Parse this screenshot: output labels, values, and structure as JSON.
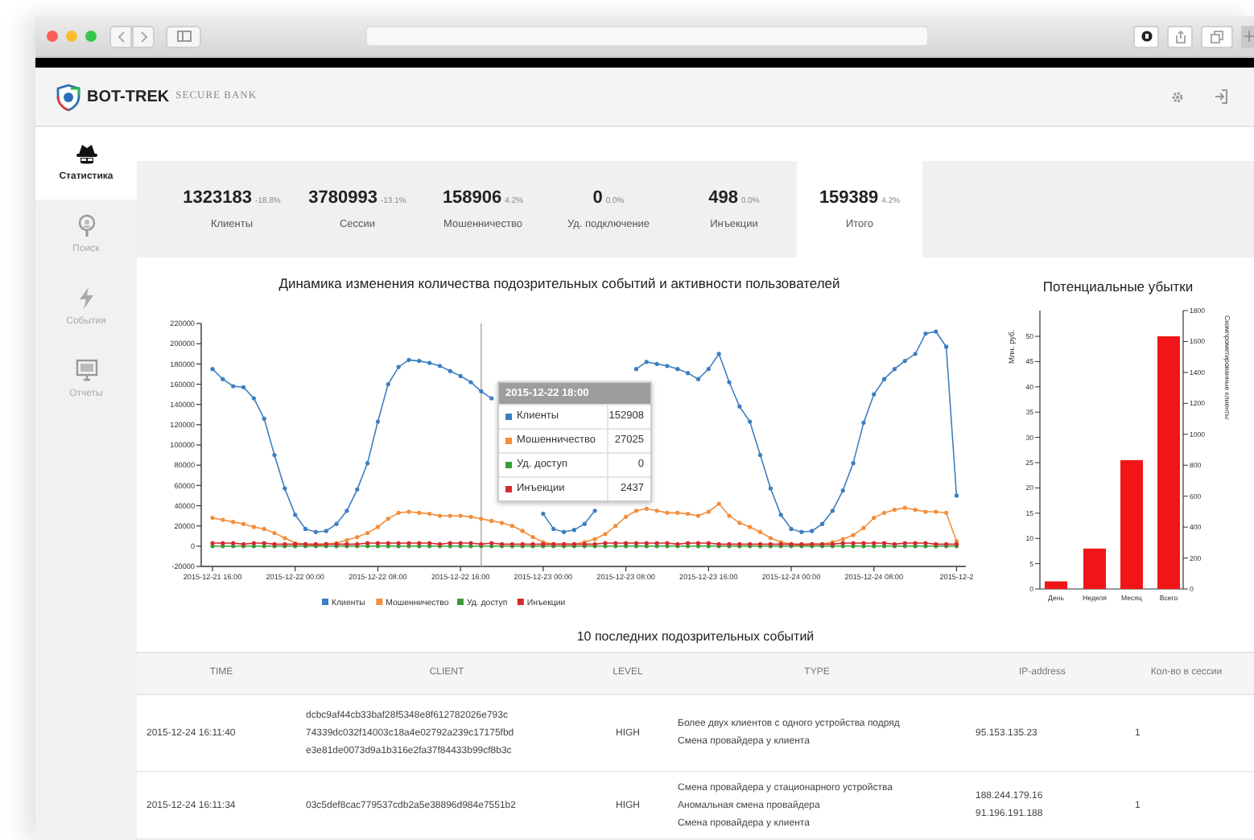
{
  "header": {
    "brand": "BOT-TREK",
    "subtitle": "SECURE BANK"
  },
  "sidebar": {
    "items": [
      {
        "label": "Статистика",
        "kind": "agent",
        "selected": true
      },
      {
        "label": "Поиск",
        "kind": "search",
        "selected": false
      },
      {
        "label": "События",
        "kind": "lightning",
        "selected": false
      },
      {
        "label": "Отчеты",
        "kind": "monitor",
        "selected": false
      }
    ]
  },
  "stats": [
    {
      "value": "1323183",
      "change": "-18.8%",
      "label": "Клиенты",
      "selected": false
    },
    {
      "value": "3780993",
      "change": "-13.1%",
      "label": "Сессии",
      "selected": false
    },
    {
      "value": "158906",
      "change": "4.2%",
      "label": "Мошенничество",
      "selected": false
    },
    {
      "value": "0",
      "change": "0.0%",
      "label": "Уд. подключение",
      "selected": false
    },
    {
      "value": "498",
      "change": "0.0%",
      "label": "Инъекции",
      "selected": false
    },
    {
      "value": "159389",
      "change": "4.2%",
      "label": "Итого",
      "selected": true
    }
  ],
  "line_chart": {
    "chart_data": {
      "type": "line",
      "title": "Динамика изменения количества подозрительных событий и активности пользователей",
      "categories": [
        "2015-12-21 16:00",
        null,
        null,
        null,
        null,
        null,
        null,
        null,
        "2015-12-22 00:00",
        null,
        null,
        null,
        null,
        null,
        null,
        null,
        "2015-12-22 08:00",
        null,
        null,
        null,
        null,
        null,
        null,
        null,
        "2015-12-22 16:00",
        null,
        null,
        null,
        null,
        null,
        null,
        null,
        "2015-12-23 00:00",
        null,
        null,
        null,
        null,
        null,
        null,
        null,
        "2015-12-23 08:00",
        null,
        null,
        null,
        null,
        null,
        null,
        null,
        "2015-12-23 16:00",
        null,
        null,
        null,
        null,
        null,
        null,
        null,
        "2015-12-24 00:00",
        null,
        null,
        null,
        null,
        null,
        null,
        null,
        "2015-12-24 08:00",
        null,
        null,
        null,
        null,
        null,
        null,
        null,
        "2015-12-2"
      ],
      "legend": true,
      "ylim": [
        -20000,
        220000
      ],
      "yticks": [
        -20000,
        0,
        20000,
        40000,
        60000,
        80000,
        100000,
        120000,
        140000,
        160000,
        180000,
        200000,
        220000
      ],
      "series": [
        {
          "name": "Клиенты",
          "color": "#3c7fc0",
          "values": [
            175000,
            165000,
            158000,
            157000,
            146000,
            126000,
            90000,
            57000,
            31000,
            17000,
            14000,
            15000,
            22000,
            35000,
            56000,
            82000,
            123000,
            160000,
            177000,
            184000,
            183000,
            181000,
            178000,
            173000,
            168000,
            162000,
            153000,
            146000,
            null,
            null,
            null,
            null,
            32000,
            17000,
            14000,
            16000,
            22000,
            35000,
            null,
            null,
            null,
            175000,
            182000,
            180000,
            178000,
            175000,
            171000,
            165000,
            175000,
            190000,
            162000,
            138000,
            123000,
            90000,
            57000,
            31000,
            17000,
            14000,
            15000,
            22000,
            35000,
            55000,
            82000,
            122000,
            150000,
            165000,
            175000,
            183000,
            190000,
            210000,
            212000,
            197000,
            50000
          ]
        },
        {
          "name": "Мошенничество",
          "color": "#f28e3c",
          "values": [
            28000,
            26000,
            24000,
            22000,
            19000,
            17000,
            13000,
            8000,
            3000,
            2000,
            1000,
            2000,
            3000,
            6000,
            9000,
            13000,
            19000,
            27000,
            33000,
            34000,
            33000,
            32000,
            30000,
            30000,
            30000,
            29000,
            27000,
            25000,
            23000,
            20000,
            15000,
            9000,
            4000,
            2000,
            2000,
            2000,
            4000,
            7000,
            12000,
            20000,
            29000,
            35000,
            37000,
            35000,
            33000,
            33000,
            32000,
            30000,
            34000,
            42000,
            30000,
            23000,
            19000,
            14000,
            8000,
            4000,
            2000,
            1000,
            2000,
            2000,
            4000,
            7000,
            11000,
            18000,
            28000,
            33000,
            36000,
            38000,
            36000,
            34000,
            34000,
            33000,
            5000
          ]
        },
        {
          "name": "Уд. доступ",
          "color": "#3a9b3a",
          "values": [
            0,
            0,
            0,
            0,
            0,
            0,
            0,
            0,
            0,
            0,
            0,
            0,
            0,
            0,
            0,
            0,
            0,
            0,
            0,
            0,
            0,
            0,
            0,
            0,
            0,
            0,
            0,
            0,
            0,
            0,
            0,
            0,
            0,
            0,
            0,
            0,
            0,
            0,
            0,
            0,
            0,
            0,
            0,
            0,
            0,
            0,
            0,
            0,
            0,
            0,
            0,
            0,
            0,
            0,
            0,
            0,
            0,
            0,
            0,
            0,
            0,
            0,
            0,
            0,
            0,
            0,
            0,
            0,
            0,
            0,
            0,
            0,
            0
          ]
        },
        {
          "name": "Инъекции",
          "color": "#d42a2f",
          "values": [
            3000,
            3000,
            3000,
            2000,
            3000,
            3000,
            2000,
            2000,
            2000,
            2000,
            2000,
            2000,
            2000,
            2000,
            2000,
            3000,
            3000,
            3000,
            3000,
            3000,
            3000,
            3000,
            2000,
            3000,
            3000,
            3000,
            2000,
            3000,
            2000,
            2000,
            2000,
            2000,
            2000,
            2000,
            2000,
            2000,
            2000,
            2000,
            3000,
            3000,
            3000,
            3000,
            3000,
            3000,
            3000,
            2000,
            3000,
            3000,
            3000,
            2000,
            2000,
            2000,
            2000,
            2000,
            2000,
            2000,
            2000,
            2000,
            2000,
            2000,
            2000,
            3000,
            3000,
            3000,
            3000,
            3000,
            2000,
            3000,
            3000,
            3000,
            2000,
            2000,
            2000
          ]
        }
      ]
    },
    "tooltip": {
      "title": "2015-12-22 18:00",
      "rows": [
        {
          "label": "Клиенты",
          "value": "152908",
          "color": "#3c7fc0"
        },
        {
          "label": "Мошенничество",
          "value": "27025",
          "color": "#f28e3c"
        },
        {
          "label": "Уд. доступ",
          "value": "0",
          "color": "#3a9b3a"
        },
        {
          "label": "Инъекции",
          "value": "2437",
          "color": "#d42a2f"
        }
      ]
    }
  },
  "bar_chart": {
    "chart_data": {
      "type": "bar",
      "title": "Потенциальные убытки",
      "ylabel": "Млн. руб.",
      "categories": [
        "День",
        "Неделя",
        "Месяц",
        "Всего"
      ],
      "values": [
        1.5,
        8,
        25.5,
        50
      ],
      "ylim": [
        0,
        55
      ],
      "yticks": [
        0,
        5,
        10,
        15,
        20,
        25,
        30,
        35,
        40,
        45,
        50
      ],
      "y2label": "Скомпрометированные клиенты",
      "y2lim": [
        0,
        1800
      ],
      "y2ticks": [
        0,
        200,
        400,
        600,
        800,
        1000,
        1200,
        1400,
        1600,
        1800
      ]
    }
  },
  "events_table": {
    "title": "10 последних подозрительных событий",
    "columns": [
      "TIME",
      "CLIENT",
      "LEVEL",
      "TYPE",
      "IP-address",
      "Кол-во в сессии"
    ],
    "rows": [
      {
        "time": "2015-12-24 16:11:40",
        "client": [
          "dcbc9af44cb33baf28f5348e8f612782026e793c",
          "74339dc032f14003c18a4e02792a239c17175fbd",
          "e3e81de0073d9a1b316e2fa37f84433b99cf8b3c"
        ],
        "level": "HIGH",
        "type": [
          "Более двух клиентов с одного устройства подряд",
          "Смена провайдера у клиента"
        ],
        "ip": [
          "95.153.135.23"
        ],
        "count": "1"
      },
      {
        "time": "2015-12-24 16:11:34",
        "client": [
          "03c5def8cac779537cdb2a5e38896d984e7551b2"
        ],
        "level": "HIGH",
        "type": [
          "Смена провайдера у стационарного устройства",
          "Аномальная смена провайдера",
          "Смена провайдера у клиента"
        ],
        "ip": [
          "188.244.179.16",
          "91.196.191.188"
        ],
        "count": "1"
      }
    ]
  }
}
